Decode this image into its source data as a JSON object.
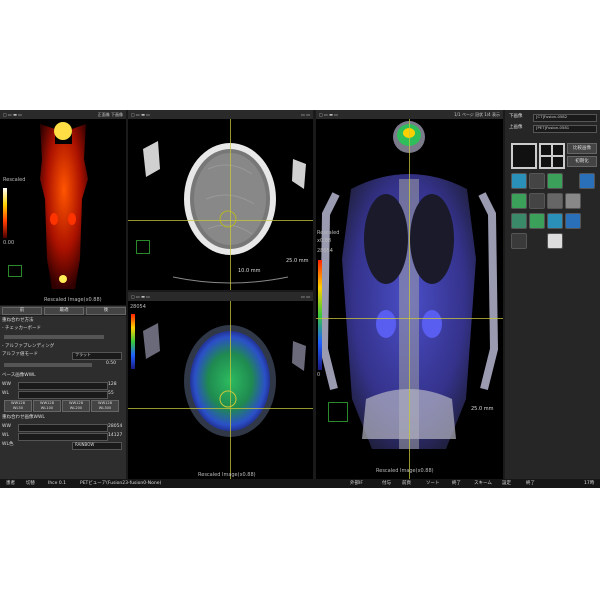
{
  "left_top_view": {
    "header_right": "正面像 下画像",
    "rescaled": "Rescaled",
    "scale_min": "0.00",
    "bottom_caption": "Rescaled Image(x0.88)"
  },
  "tabs": [
    "前",
    "最適",
    "後"
  ],
  "controls": {
    "section_title": "重ね合わせ方法",
    "checker": "- チェッカーボード",
    "alpha_blend": "- アルファブレンディング",
    "alpha_label": "アルファ値モード",
    "alpha_value": "フラット",
    "alpha_num": "0.50",
    "base_title": "ベース画像WWL",
    "ww_label": "WW",
    "ww_value": "128",
    "wl_label": "WL",
    "wl_value": "55",
    "presets": [
      {
        "top": "WW128",
        "bottom": "WL50"
      },
      {
        "top": "WW128",
        "bottom": "WL100"
      },
      {
        "top": "WW128",
        "bottom": "WL200"
      },
      {
        "top": "WW128",
        "bottom": "WL300"
      }
    ],
    "overlay_title": "重ね合わせ画像WWL",
    "ww2_value": "28054",
    "wl2_value": "14127",
    "color_label": "WL色",
    "color_value": "RAINBOW"
  },
  "axial_ct": {
    "scale": "25.0 mm",
    "left_scale": "10.0 mm"
  },
  "axial_fusion": {
    "max": "28054",
    "caption": "Rescaled Image(x0.88)"
  },
  "coronal": {
    "header_right": "1/1 ページ 冠状 1/4 表示",
    "rescaled": "Rescaled",
    "scale_factor": "x0.88",
    "max": "28054",
    "min": "0",
    "scale": "25.0 mm",
    "caption": "Rescaled Image(x0.88)"
  },
  "right_panel": {
    "lower_label": "下画像",
    "lower_value": "[CT]Fusion-0582",
    "upper_label": "上画像",
    "upper_value": "[PET]Fusion-0581",
    "compare": "比較画像",
    "init": "初期化"
  },
  "taskbar": {
    "items": [
      "患者",
      "切替",
      "Ihce 0.1",
      "PETビューア(Fusion23-fusion0-None)",
      "外部IF",
      "付与",
      "前頁",
      "ソート",
      "終了",
      "スキーム",
      "設定",
      "終了"
    ],
    "clock": "17時"
  },
  "colors": {
    "accent": "#2b6cb0",
    "overlay_line": "#c8c838",
    "pet_red": "#ff3300"
  }
}
